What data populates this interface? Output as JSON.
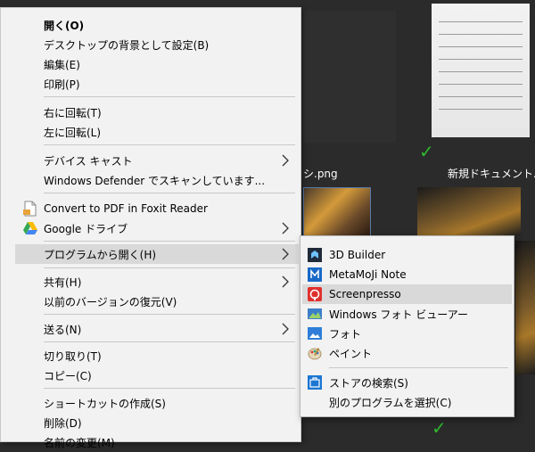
{
  "background": {
    "files": [
      {
        "label": "シ.png"
      },
      {
        "label": "新規ドキュメント.pdf"
      }
    ]
  },
  "menu": {
    "items": [
      {
        "label": "開く(O)"
      },
      {
        "label": "デスクトップの背景として設定(B)"
      },
      {
        "label": "編集(E)"
      },
      {
        "label": "印刷(P)"
      },
      {
        "label": "右に回転(T)"
      },
      {
        "label": "左に回転(L)"
      },
      {
        "label": "デバイス キャスト"
      },
      {
        "label": "Windows Defender でスキャンしています..."
      },
      {
        "label": "Convert to PDF in Foxit Reader"
      },
      {
        "label": "Google ドライブ"
      },
      {
        "label": "プログラムから開く(H)"
      },
      {
        "label": "共有(H)"
      },
      {
        "label": "以前のバージョンの復元(V)"
      },
      {
        "label": "送る(N)"
      },
      {
        "label": "切り取り(T)"
      },
      {
        "label": "コピー(C)"
      },
      {
        "label": "ショートカットの作成(S)"
      },
      {
        "label": "削除(D)"
      },
      {
        "label": "名前の変更(M)"
      }
    ]
  },
  "submenu": {
    "items": [
      {
        "label": "3D Builder"
      },
      {
        "label": "MetaMoJi Note"
      },
      {
        "label": "Screenpresso"
      },
      {
        "label": "Windows フォト ビューアー"
      },
      {
        "label": "フォト"
      },
      {
        "label": "ペイント"
      },
      {
        "label": "ストアの検索(S)"
      },
      {
        "label": "別のプログラムを選択(C)"
      }
    ]
  },
  "colors": {
    "menu_bg": "#f2f2f2",
    "highlight": "#d9d9d9",
    "explorer_bg": "#2b2b2b",
    "check_green": "#2eb82e"
  }
}
